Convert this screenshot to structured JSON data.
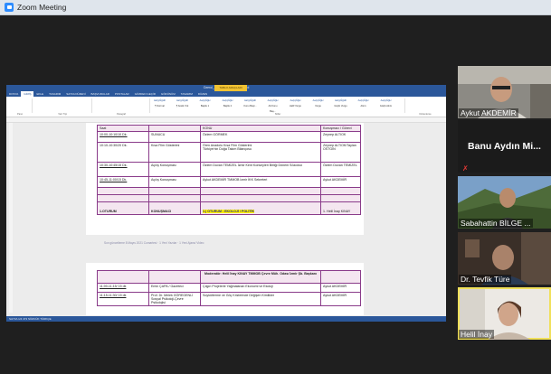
{
  "window": {
    "title": "Zoom Meeting"
  },
  "word": {
    "doc_title": "Ozerol_Turizm_Prog2-07 - Word",
    "contextual_tab": "TABLO ARAÇLARI",
    "tabs": [
      "DOSYA",
      "GİRİŞ",
      "EKLE",
      "TASARIM",
      "SAYFA DÜZENİ",
      "BAŞVURULAR",
      "POSTALAR",
      "GÖZDEN GEÇİR",
      "GÖRÜNÜM",
      "TASARIM",
      "DÜZEN"
    ],
    "ribbon_groups": [
      "Pano",
      "Yazı Tipi",
      "Paragraf",
      "Stiller",
      "Düzenleme"
    ],
    "styles": [
      "AaÇçĞğHh",
      "AaÇçĞğHh",
      "AaÇçĞğH",
      "AaÇçĞğH",
      "AaÇçĞğHh",
      "AaÇçĞğH",
      "AaÇçĞğH",
      "AaÇçĞğH",
      "AaÇçĞğHh",
      "AaÇçĞğH",
      "AaÇçĞğH"
    ],
    "style_names": [
      "¶ Normal",
      "¶ Aralık Yok",
      "Başlık 1",
      "Başlık 2",
      "Konu Başl...",
      "Alt Konu Baş...",
      "Hafif Vurgu",
      "Vurgu",
      "Güçlü Vurgu",
      "Alıntı",
      "Güçlü Alıntı"
    ],
    "table1": {
      "header": [
        "Saat",
        "KONU",
        "Konuşmacı / Görevi"
      ],
      "rows": [
        [
          "10:00-10:10/10 Dk.",
          "SUNUCU",
          "Özlem GÖRMEK",
          "Zeynep ALTIOK"
        ],
        [
          "10:10-10:30/20 Dk.",
          "Kısa Film Gösterimi",
          "Ören Anadolu Kısa Film Gösterimi\nTürkiye'nin Doğa Takım Bilançosu",
          "Zeynep ALTIOK/Taylan OSTGIN"
        ],
        [
          "10:30-10:45/15 Dk.",
          "Açılış Konuşması",
          "Özlem Duvan TEMİZEL İzmir Kent Konseyleri Birliği Dönem Sözcüsü",
          "Özlem Duvan TEMİZEL"
        ],
        [
          "10:45-11:00/15 Dk.",
          "Açılış Konuşması",
          "Aykut AKDEMİR TMMOB İzmir İKK Sekreteri",
          "Aykut AKDEMİR"
        ]
      ],
      "session_row": [
        "1.OTURUM",
        "KONUŞMACI",
        "1.) OTURUM : EKOLOJİ / POLİTİK",
        "1. Helil İnay KINAY"
      ]
    },
    "page_footer": "Son güncelleme 8 Mayıs 2021 Cumartesi · 1 Yeni Yazılar · 1 Yeni Ajans/ Video",
    "table2": {
      "moderator": "Moderatör: Helil İnay KINAY TMMOB Çevre Müh. Odası İzmir Şb. Başkanı",
      "rows": [
        [
          "11:00-11:15/ 15 dk",
          "Emin ÇAPA / Gazeteci",
          "Çılgın Projelerle Yağmalanan Ekonomi ve Ekoloji",
          "Aykut AKDEMİR"
        ],
        [
          "11:15-11:30/ 15 dk",
          "Prof. Dr. Melek GÖREGENLİ Sosyal Psikoloji-Çevre Psikolojisi",
          "Soykütlerme ve Göç Krizlerinde Değişen Kimlikler",
          "Aykut AKDEMİR"
        ]
      ]
    },
    "status_bar": "SAYFA 1/4   473 SÖZCÜK   TÜRKÇE"
  },
  "participants": [
    {
      "name": "Aykut AKDEMİR",
      "video": true
    },
    {
      "name": "Banu Aydın Mi...",
      "video": false
    },
    {
      "name": "Sabahattin BİLGE ...",
      "video": true
    },
    {
      "name": "Dr. Tevfik Türe",
      "video": true
    },
    {
      "name": "Helil İnay",
      "video": true,
      "active_speaker": true
    }
  ]
}
